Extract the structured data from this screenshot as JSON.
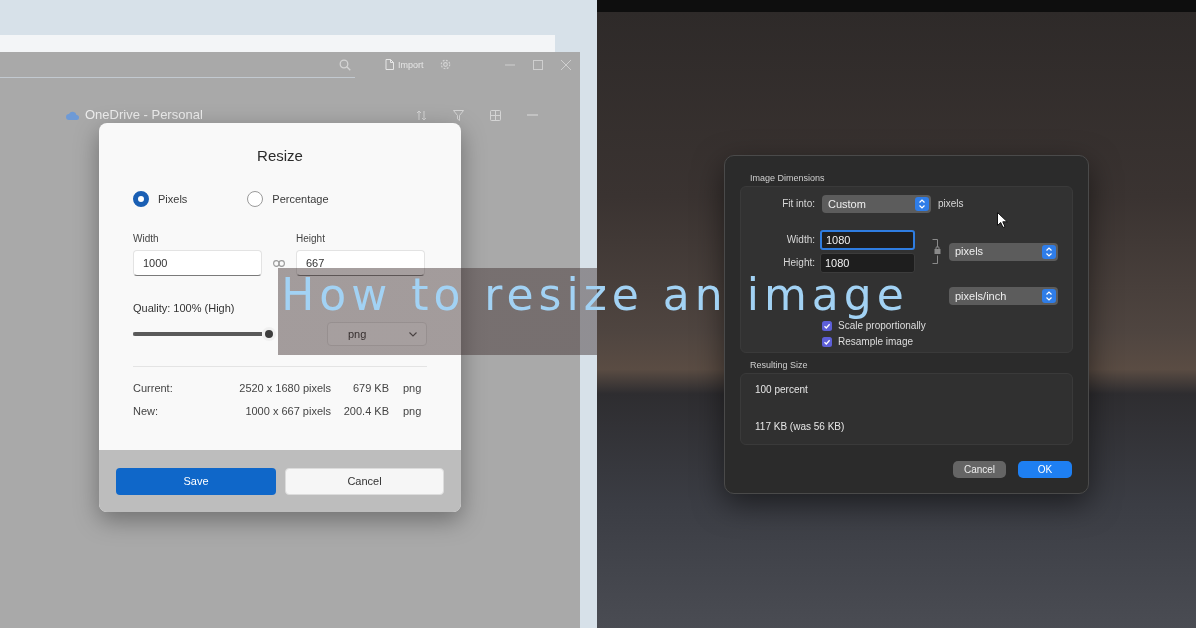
{
  "left_panel": {
    "paint_window": {
      "import_label": "Import",
      "location": "OneDrive - Personal"
    },
    "resize_dialog": {
      "title": "Resize",
      "units": [
        {
          "label": "Pixels",
          "selected": true
        },
        {
          "label": "Percentage",
          "selected": false
        }
      ],
      "width": {
        "label": "Width",
        "value": "1000"
      },
      "height": {
        "label": "Height",
        "value": "667"
      },
      "quality": {
        "label": "Quality: 100% (High)",
        "level": 1
      },
      "format_dropdown": {
        "value": "png"
      },
      "info_rows": [
        {
          "label": "Current:",
          "dimensions": "2520 x 1680 pixels",
          "size": "679 KB",
          "format": "png"
        },
        {
          "label": "New:",
          "dimensions": "1000 x 667 pixels",
          "size": "200.4 KB",
          "format": "png"
        }
      ],
      "buttons": [
        {
          "label": "Save",
          "kind": "primary"
        },
        {
          "label": "Cancel",
          "kind": "secondary"
        }
      ]
    }
  },
  "right_panel": {
    "image_size_dialog": {
      "dimensions": {
        "title": "Image Dimensions",
        "fit_into": {
          "label": "Fit into:",
          "value": "Custom",
          "unit": "pixels"
        },
        "width": {
          "label": "Width:",
          "value": "1080"
        },
        "height": {
          "label": "Height:",
          "value": "1080"
        },
        "size_unit": "pixels",
        "resolution_unit": "pixels/inch",
        "options": [
          {
            "label": "Scale proportionally",
            "checked": true
          },
          {
            "label": "Resample image",
            "checked": true
          }
        ]
      },
      "result": {
        "title": "Resulting Size",
        "percent": "100 percent",
        "file_size": "117 KB (was 56 KB)"
      },
      "buttons": [
        {
          "label": "Cancel",
          "kind": "secondary"
        },
        {
          "label": "OK",
          "kind": "primary"
        }
      ]
    }
  },
  "title_banner": {
    "title": "How to resize an image"
  }
}
